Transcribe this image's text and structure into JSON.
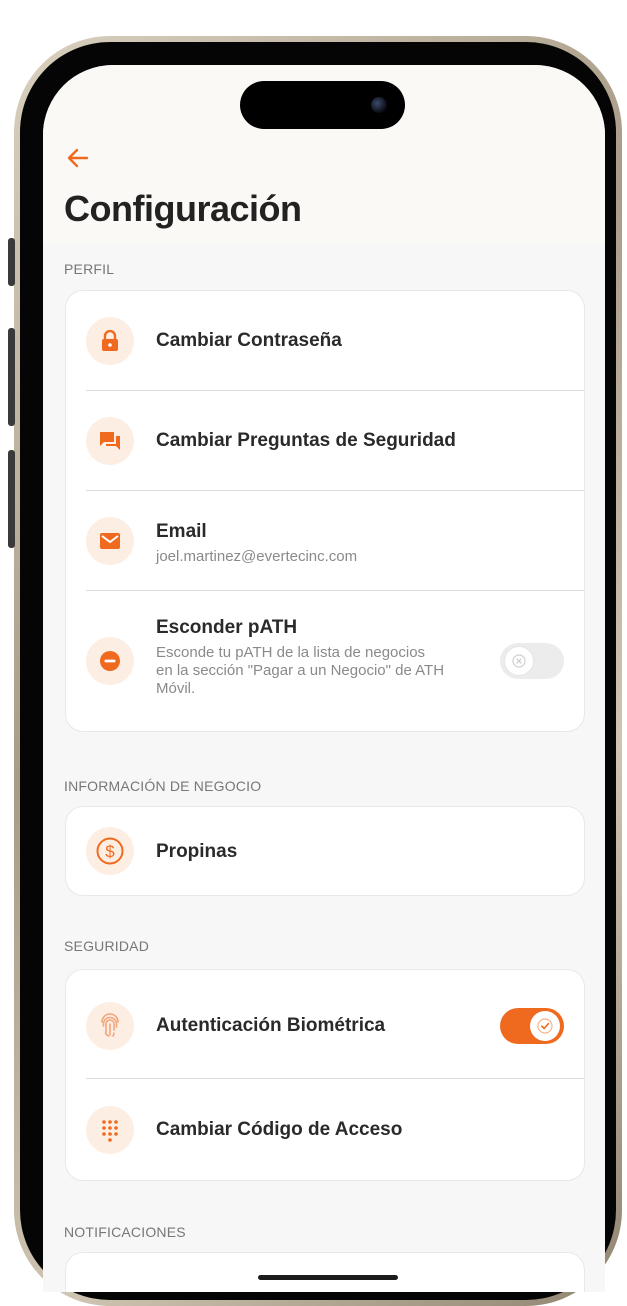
{
  "header": {
    "title": "Configuración"
  },
  "sections": {
    "perfil": "PERFIL",
    "negocio": "INFORMACIÓN DE NEGOCIO",
    "seguridad": "SEGURIDAD",
    "notificaciones": "NOTIFICACIONES"
  },
  "perfil_items": {
    "password": {
      "title": "Cambiar Contraseña",
      "icon": "lock-icon"
    },
    "questions": {
      "title": "Cambiar Preguntas de Seguridad",
      "icon": "chat-bubble-icon"
    },
    "email": {
      "title": "Email",
      "value": "joel.martinez@evertecinc.com",
      "icon": "mail-icon"
    },
    "hide_path": {
      "title": "Esconder pATH",
      "desc_line1": "Esconde tu pATH de la lista de negocios",
      "desc_line2": "en la sección \"Pagar a un Negocio\" de ATH",
      "desc_line3": "Móvil.",
      "icon": "minus-circle-icon",
      "enabled": false
    }
  },
  "negocio_items": {
    "tips": {
      "title": "Propinas",
      "icon": "dollar-circle-icon"
    }
  },
  "seguridad_items": {
    "biometric": {
      "title": "Autenticación Biométrica",
      "icon": "fingerprint-icon",
      "enabled": true
    },
    "access_code": {
      "title": "Cambiar Código de Acceso",
      "icon": "keypad-icon"
    }
  },
  "colors": {
    "accent": "#ef6a1e",
    "icon_bg": "#fdeee4",
    "background": "#f7f7f7"
  }
}
